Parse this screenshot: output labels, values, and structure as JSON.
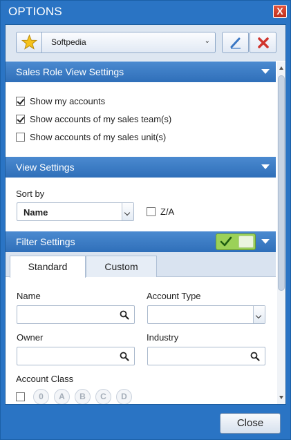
{
  "window": {
    "title": "OPTIONS",
    "close_glyph": "X"
  },
  "profile": {
    "name": "Softpedia",
    "icon": "star-icon",
    "edit_icon": "pencil-icon",
    "delete_icon": "delete-x-icon"
  },
  "sales_role": {
    "header": "Sales Role View Settings",
    "options": [
      {
        "label": "Show my accounts",
        "checked": true
      },
      {
        "label": "Show accounts of my sales team(s)",
        "checked": true
      },
      {
        "label": "Show accounts of my sales unit(s)",
        "checked": false
      }
    ]
  },
  "view_settings": {
    "header": "View Settings",
    "sort_label": "Sort by",
    "sort_value": "Name",
    "za_label": "Z/A",
    "za_checked": false
  },
  "filter_settings": {
    "header": "Filter Settings",
    "enabled": true,
    "tabs": [
      "Standard",
      "Custom"
    ],
    "active_tab": "Standard",
    "fields": {
      "name_label": "Name",
      "account_type_label": "Account Type",
      "owner_label": "Owner",
      "industry_label": "Industry",
      "account_class_label": "Account Class"
    },
    "account_classes": [
      "0",
      "A",
      "B",
      "C",
      "D"
    ]
  },
  "footer": {
    "close_label": "Close"
  },
  "colors": {
    "title_bar": "#2a74c4",
    "section_header": "#3b7cc6",
    "toggle_on": "#9bd158",
    "delete_red": "#d0342c"
  }
}
